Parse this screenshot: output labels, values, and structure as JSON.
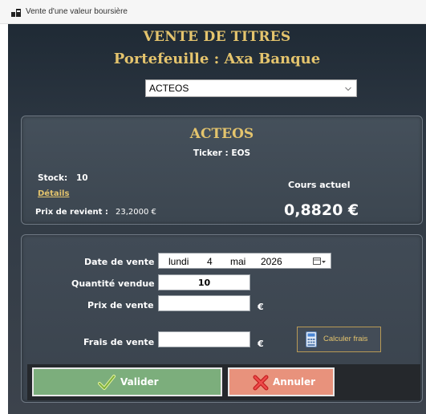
{
  "window": {
    "title": "Vente d'une valeur boursière"
  },
  "header": {
    "title": "VENTE DE TITRES",
    "portfolio": "Portefeuille : Axa Banque"
  },
  "security_select": {
    "selected": "ACTEOS",
    "icon": "chevron-down-icon"
  },
  "info": {
    "name": "ACTEOS",
    "ticker_label": "Ticker : EOS",
    "stock_label": "Stock:",
    "stock_value": "10",
    "details_link": "Détails",
    "cost_label": "Prix de revient :",
    "cost_value": "23,2000 €",
    "price_label": "Cours actuel",
    "price_value": "0,8820 €"
  },
  "form": {
    "date_label": "Date de vente",
    "date_weekday": "lundi",
    "date_day": "4",
    "date_month": "mai",
    "date_year": "2026",
    "qty_label": "Quantité vendue",
    "qty_value": "10",
    "price_label": "Prix de vente",
    "price_value": "",
    "price_unit": "€",
    "fees_label": "Frais de vente",
    "fees_value": "",
    "fees_unit": "€",
    "calc_button": "Calculer frais"
  },
  "actions": {
    "validate": "Valider",
    "cancel": "Annuler"
  },
  "colors": {
    "accent_gold": "#e4c46d",
    "validate_green": "#7cae7c",
    "cancel_salmon": "#e8927c",
    "background_dark": "#2f3944"
  }
}
